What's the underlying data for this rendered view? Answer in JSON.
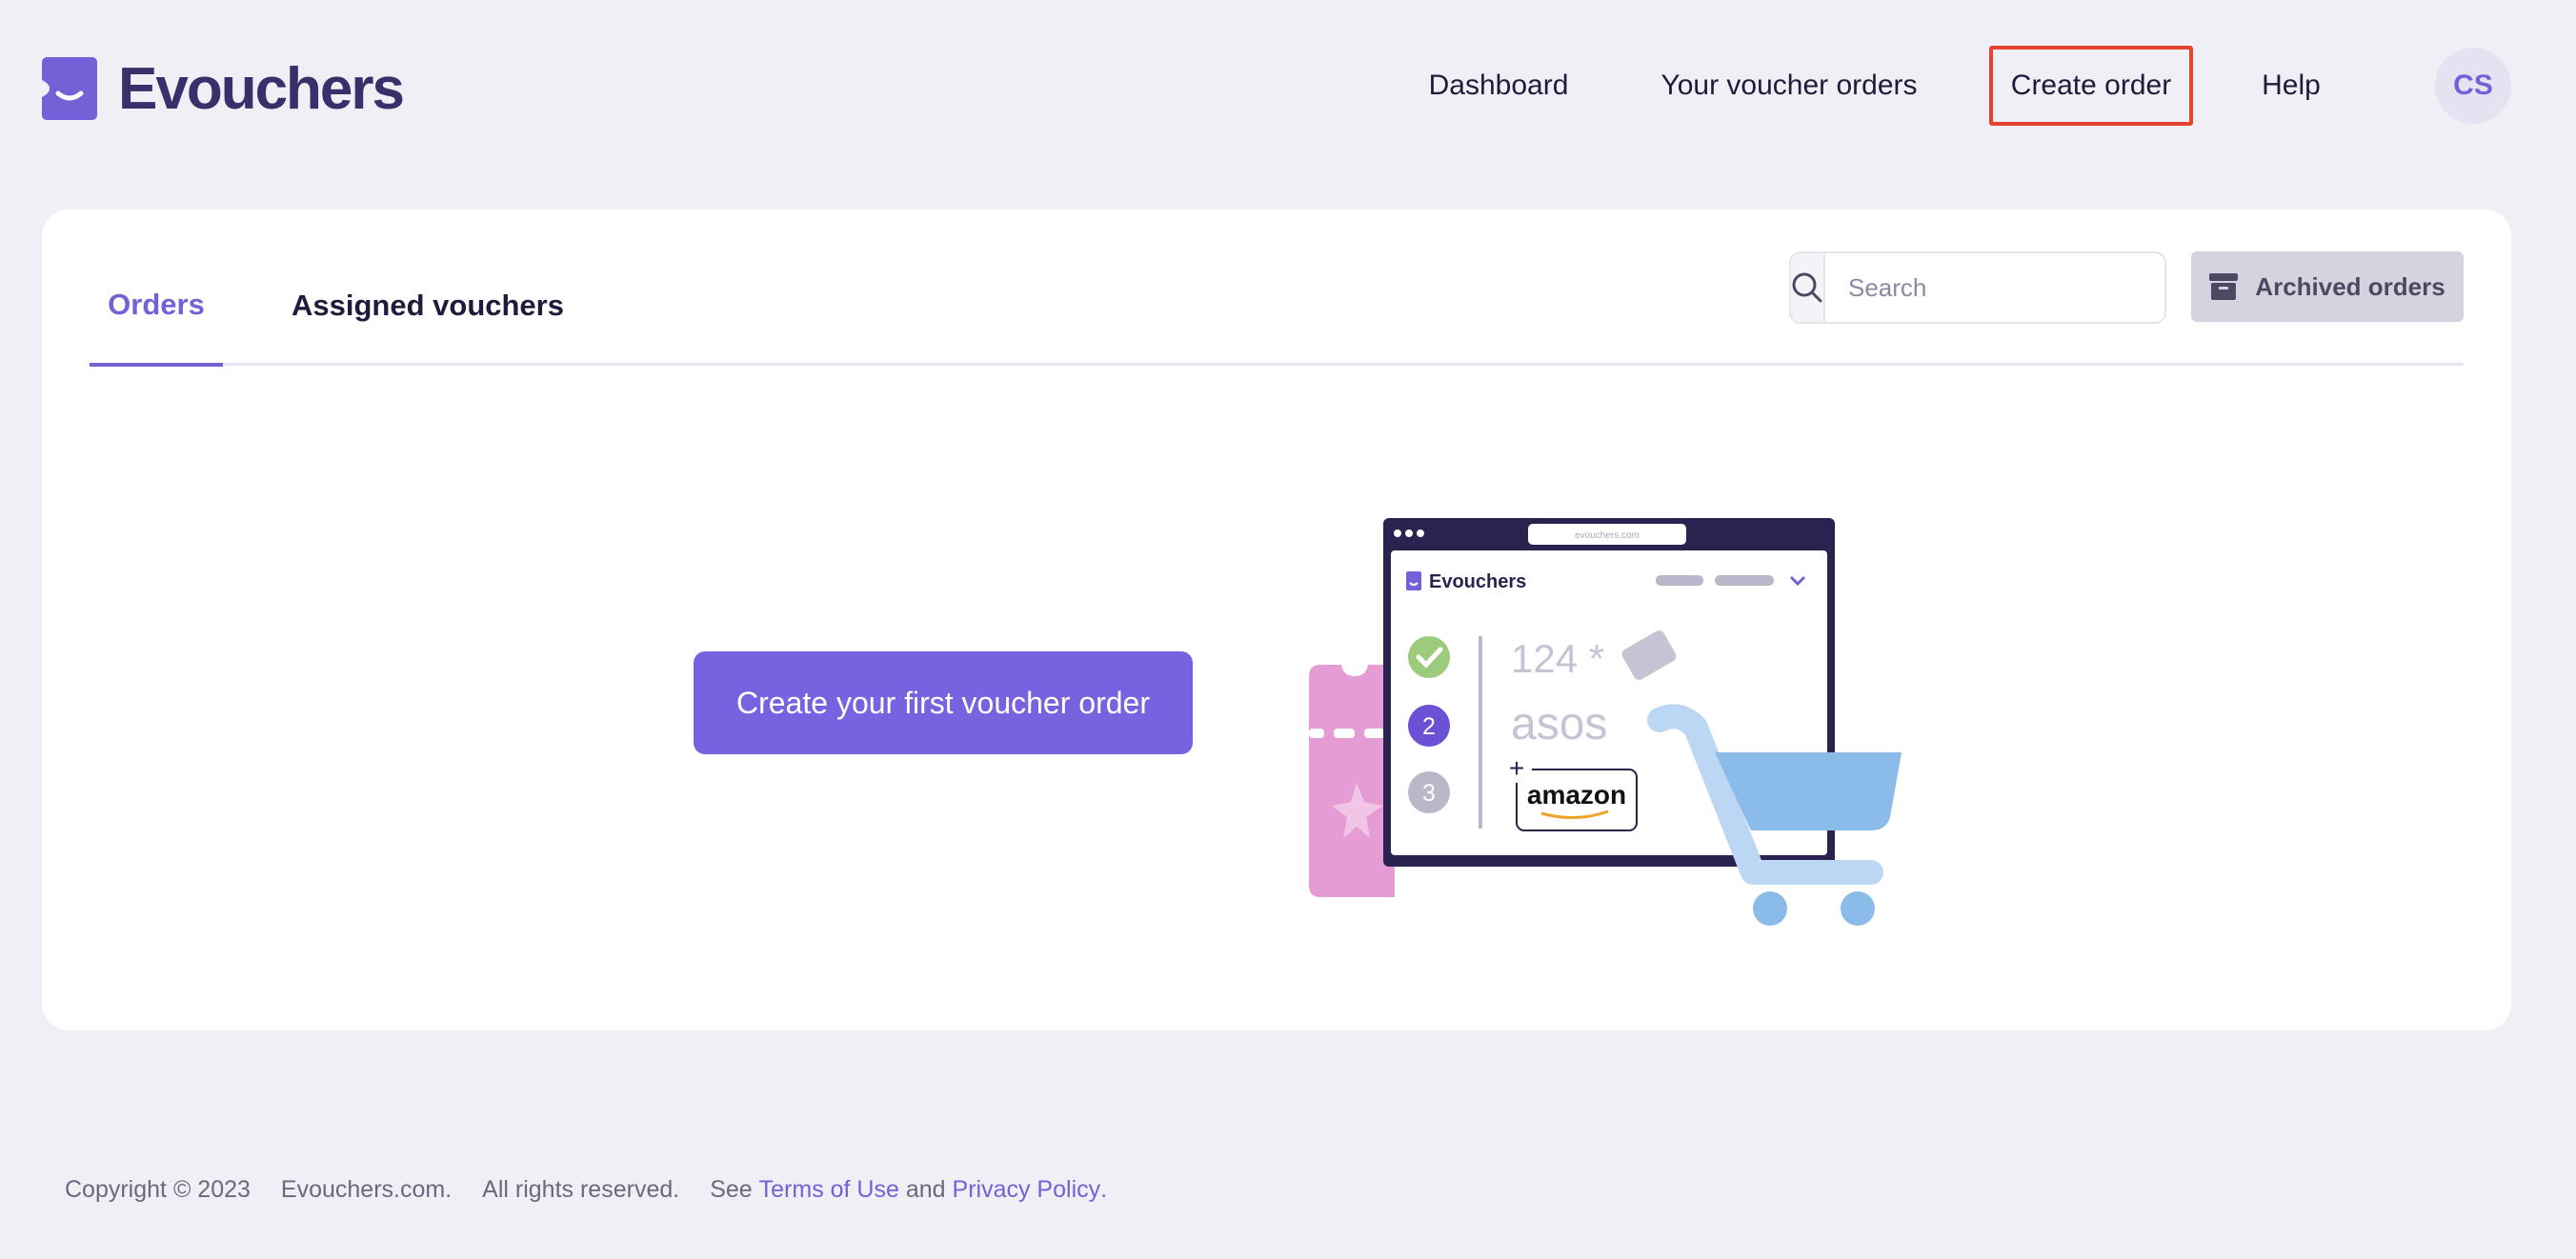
{
  "brand": {
    "name": "Evouchers",
    "color": "#7461d8"
  },
  "nav": {
    "dashboard": "Dashboard",
    "voucher_orders": "Your voucher orders",
    "create_order": "Create order",
    "help": "Help",
    "avatar_initials": "CS",
    "highlight_color": "#e2442f"
  },
  "tabs": [
    {
      "label": "Orders",
      "active": true
    },
    {
      "label": "Assigned vouchers",
      "active": false
    }
  ],
  "search": {
    "placeholder": "Search",
    "value": ""
  },
  "archived_button": "Archived orders",
  "cta_button": "Create your first voucher order",
  "illustration": {
    "url": "evouchers.com",
    "brand": "Evouchers",
    "steps": [
      "2",
      "3"
    ],
    "text_124": "124 *",
    "asos": "asos",
    "amazon": "amazon",
    "plus": "+"
  },
  "footer": {
    "copyright": "Copyright © 2023",
    "site": "Evouchers.com.",
    "rights": "All rights reserved.",
    "see": "See",
    "terms": "Terms of Use",
    "and": "and",
    "privacy": "Privacy Policy",
    "period": "."
  }
}
